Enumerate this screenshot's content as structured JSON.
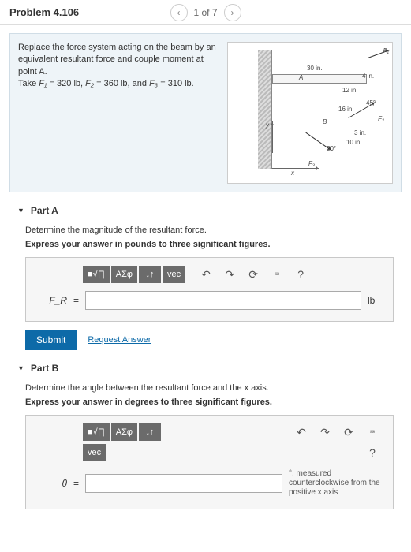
{
  "header": {
    "title": "Problem 4.106",
    "nav_label": "1 of 7"
  },
  "problem": {
    "text_line1": "Replace the force system acting on the beam by an equivalent resultant force and couple moment at point A.",
    "text_line2_prefix": "Take ",
    "F1_label": "F₁",
    "F1_val": " = 320 lb, ",
    "F2_label": "F₂",
    "F2_val": " = 360 lb, and ",
    "F3_label": "F₃",
    "F3_val": " = 310 lb."
  },
  "figure": {
    "dim30": "30 in.",
    "dim4": "4 in.",
    "dim12": "12 in.",
    "dim16": "16 in.",
    "dim3": "3 in.",
    "dim10": "10 in.",
    "ang45": "45°",
    "ang30": "30°",
    "A": "A",
    "B": "B",
    "x": "x",
    "y": "y",
    "F1": "F₁",
    "F2": "F₂",
    "F3": "F₃"
  },
  "toolbar": {
    "templates": "■√∏",
    "greek": "ΑΣφ",
    "subsup": "↓↑",
    "vec": "vec",
    "undo": "↶",
    "redo": "↷",
    "reset": "⟳",
    "keyboard": "⌨",
    "help": "?"
  },
  "partA": {
    "title": "Part A",
    "question": "Determine the magnitude of the resultant force.",
    "instruction": "Express your answer in pounds to three significant figures.",
    "var": "F_R",
    "eq": "=",
    "unit": "lb",
    "submit": "Submit",
    "request": "Request Answer"
  },
  "partB": {
    "title": "Part B",
    "question": "Determine the angle between the resultant force and the x axis.",
    "instruction": "Express your answer in degrees to three significant figures.",
    "var": "θ",
    "eq": "=",
    "suffix": "°, measured counterclockwise from the positive x axis"
  }
}
